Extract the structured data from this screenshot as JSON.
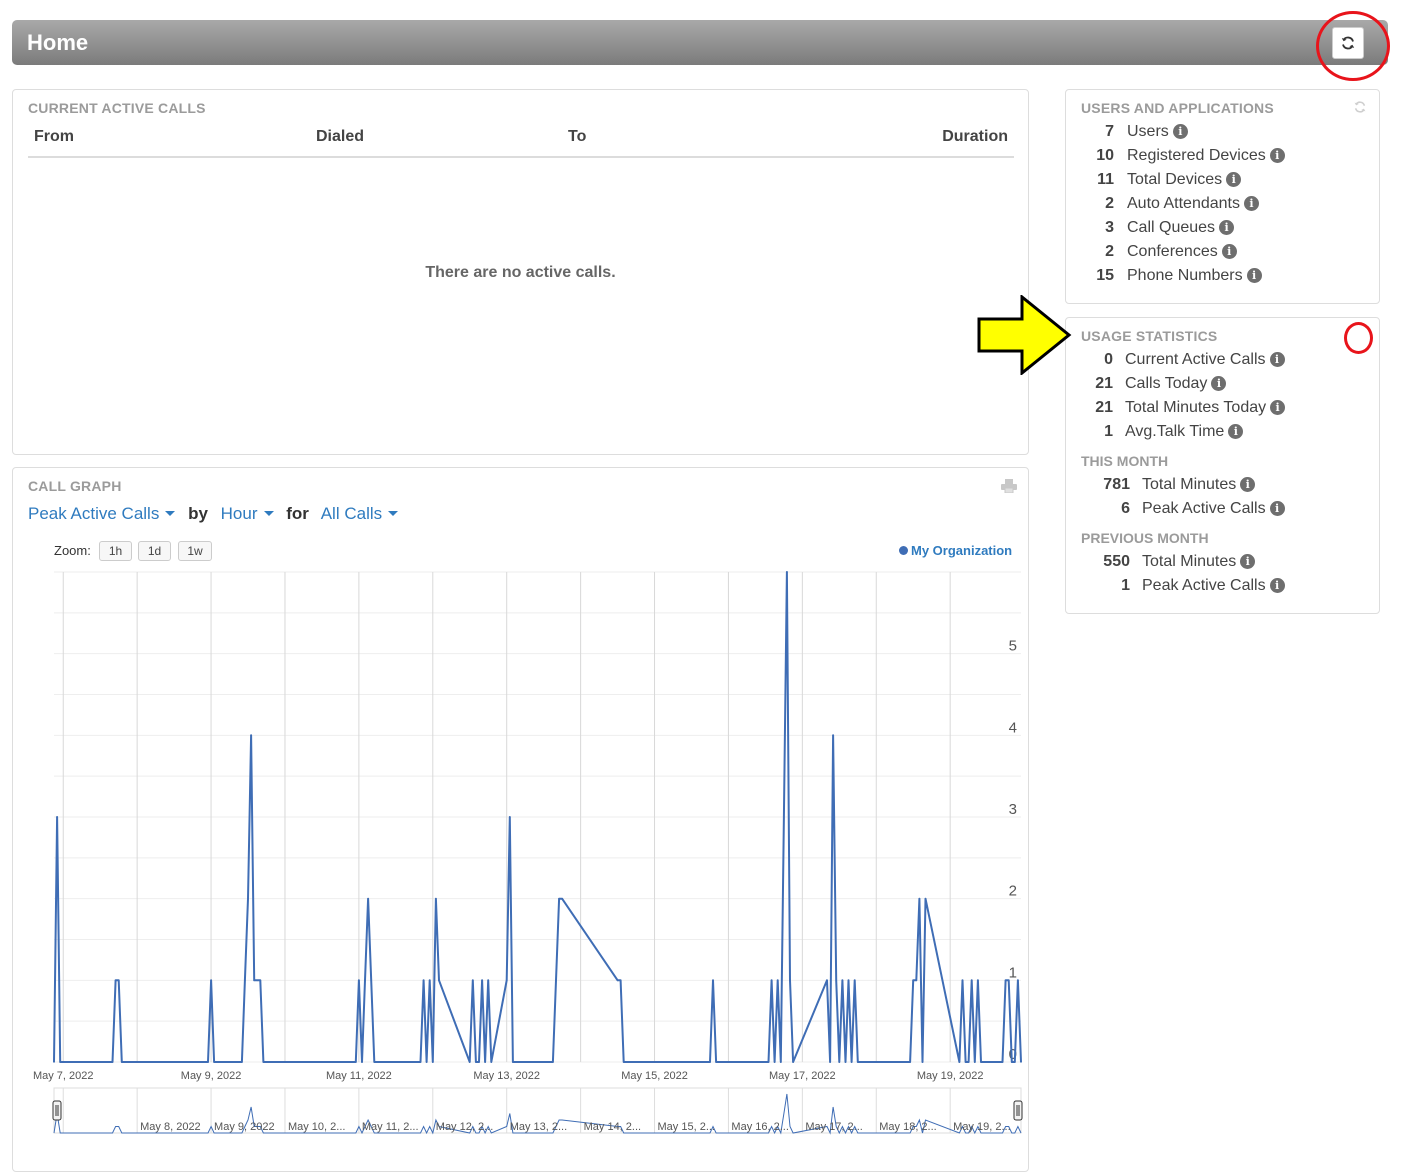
{
  "header": {
    "title": "Home"
  },
  "active_calls": {
    "title": "CURRENT ACTIVE CALLS",
    "columns": {
      "from": "From",
      "dialed": "Dialed",
      "to": "To",
      "duration": "Duration"
    },
    "empty_message": "There are no active calls."
  },
  "users_apps": {
    "title": "USERS AND APPLICATIONS",
    "items": [
      {
        "count": "7",
        "label": "Users"
      },
      {
        "count": "10",
        "label": "Registered Devices"
      },
      {
        "count": "11",
        "label": "Total Devices"
      },
      {
        "count": "2",
        "label": "Auto Attendants"
      },
      {
        "count": "3",
        "label": "Call Queues"
      },
      {
        "count": "2",
        "label": "Conferences"
      },
      {
        "count": "15",
        "label": "Phone Numbers"
      }
    ]
  },
  "usage": {
    "title": "USAGE STATISTICS",
    "items": [
      {
        "count": "0",
        "label": "Current Active Calls"
      },
      {
        "count": "21",
        "label": "Calls Today"
      },
      {
        "count": "21",
        "label": "Total Minutes Today"
      },
      {
        "count": "1",
        "label": "Avg.Talk Time"
      }
    ],
    "this_month_title": "THIS MONTH",
    "this_month": [
      {
        "count": "781",
        "label": "Total Minutes"
      },
      {
        "count": "6",
        "label": "Peak Active Calls"
      }
    ],
    "prev_month_title": "PREVIOUS MONTH",
    "prev_month": [
      {
        "count": "550",
        "label": "Total Minutes"
      },
      {
        "count": "1",
        "label": "Peak Active Calls"
      }
    ]
  },
  "call_graph": {
    "title": "CALL GRAPH",
    "metric": "Peak Active Calls",
    "by_text": "by",
    "interval": "Hour",
    "for_text": "for",
    "filter": "All Calls",
    "zoom_label": "Zoom:",
    "zoom_buttons": [
      "1h",
      "1d",
      "1w"
    ],
    "legend": "My Organization"
  },
  "colors": {
    "accent": "#2f7bbf",
    "series": "#3f6db5",
    "highlight": "#e8141b",
    "arrow": "#ffff00"
  },
  "chart_data": {
    "type": "line",
    "series": [
      {
        "name": "My Organization"
      }
    ],
    "x_range": [
      "2022-05-06T21:00",
      "2022-05-19T23:00"
    ],
    "ylim": [
      0,
      6
    ],
    "y_ticks": [
      0,
      1,
      2,
      3,
      4,
      5
    ],
    "x_tick_labels": [
      "May 7, 2022",
      "May 9, 2022",
      "May 11, 2022",
      "May 13, 2022",
      "May 15, 2022",
      "May 17, 2022",
      "May 19, 2022"
    ],
    "navigator_labels": [
      "May 8, 2022",
      "May 9, 2022",
      "May 10, 2...",
      "May 11, 2...",
      "May 12, 2...",
      "May 13, 2...",
      "May 14, 2...",
      "May 15, 2...",
      "May 16, 2...",
      "May 17, 2...",
      "May 18, 2...",
      "May 19, 2..."
    ],
    "x": [
      "2022-05-06T21:00",
      "2022-05-06T22:00",
      "2022-05-06T23:00",
      "2022-05-07T00:00",
      "2022-05-07T16:00",
      "2022-05-07T17:00",
      "2022-05-07T18:00",
      "2022-05-07T19:00",
      "2022-05-08T23:00",
      "2022-05-09T00:00",
      "2022-05-09T01:00",
      "2022-05-09T10:00",
      "2022-05-09T11:00",
      "2022-05-09T12:00",
      "2022-05-09T13:00",
      "2022-05-09T14:00",
      "2022-05-09T15:00",
      "2022-05-09T16:00",
      "2022-05-09T17:00",
      "2022-05-09T18:00",
      "2022-05-10T23:00",
      "2022-05-11T00:00",
      "2022-05-11T01:00",
      "2022-05-11T02:00",
      "2022-05-11T03:00",
      "2022-05-11T04:00",
      "2022-05-11T05:00",
      "2022-05-11T20:00",
      "2022-05-11T21:00",
      "2022-05-11T22:00",
      "2022-05-11T23:00",
      "2022-05-12T00:00",
      "2022-05-12T01:00",
      "2022-05-12T02:00",
      "2022-05-12T12:00",
      "2022-05-12T13:00",
      "2022-05-12T14:00",
      "2022-05-12T15:00",
      "2022-05-12T16:00",
      "2022-05-12T17:00",
      "2022-05-12T18:00",
      "2022-05-12T19:00",
      "2022-05-13T00:00",
      "2022-05-13T01:00",
      "2022-05-13T02:00",
      "2022-05-13T15:00",
      "2022-05-13T16:00",
      "2022-05-13T17:00",
      "2022-05-13T18:00",
      "2022-05-14T12:00",
      "2022-05-14T13:00",
      "2022-05-14T14:00",
      "2022-05-15T18:00",
      "2022-05-15T19:00",
      "2022-05-15T20:00",
      "2022-05-16T13:00",
      "2022-05-16T14:00",
      "2022-05-16T15:00",
      "2022-05-16T16:00",
      "2022-05-16T17:00",
      "2022-05-16T18:00",
      "2022-05-16T19:00",
      "2022-05-16T20:00",
      "2022-05-16T21:00",
      "2022-05-17T08:00",
      "2022-05-17T09:00",
      "2022-05-17T10:00",
      "2022-05-17T11:00",
      "2022-05-17T12:00",
      "2022-05-17T13:00",
      "2022-05-17T14:00",
      "2022-05-17T15:00",
      "2022-05-17T16:00",
      "2022-05-17T17:00",
      "2022-05-17T18:00",
      "2022-05-18T11:00",
      "2022-05-18T12:00",
      "2022-05-18T13:00",
      "2022-05-18T14:00",
      "2022-05-18T15:00",
      "2022-05-18T16:00",
      "2022-05-19T03:00",
      "2022-05-19T04:00",
      "2022-05-19T05:00",
      "2022-05-19T06:00",
      "2022-05-19T07:00",
      "2022-05-19T08:00",
      "2022-05-19T09:00",
      "2022-05-19T10:00",
      "2022-05-19T17:00",
      "2022-05-19T18:00",
      "2022-05-19T19:00",
      "2022-05-19T20:00",
      "2022-05-19T21:00",
      "2022-05-19T22:00",
      "2022-05-19T23:00"
    ],
    "y": [
      0,
      3,
      0,
      0,
      0,
      1,
      1,
      0,
      0,
      1,
      0,
      0,
      1,
      2,
      4,
      1,
      1,
      1,
      0,
      0,
      0,
      1,
      0,
      1,
      2,
      1,
      0,
      0,
      1,
      0,
      1,
      0,
      2,
      1,
      0,
      1,
      0,
      0,
      1,
      0,
      1,
      0,
      1,
      3,
      0,
      0,
      1,
      2,
      2,
      1,
      1,
      0,
      0,
      1,
      0,
      0,
      1,
      0,
      1,
      0,
      3,
      6,
      1,
      0,
      1,
      0,
      4,
      1,
      0,
      1,
      0,
      1,
      0,
      1,
      0,
      0,
      1,
      1,
      2,
      0,
      2,
      0,
      1,
      0,
      0,
      1,
      0,
      1,
      0,
      0,
      1,
      1,
      0,
      0,
      1,
      0
    ]
  }
}
